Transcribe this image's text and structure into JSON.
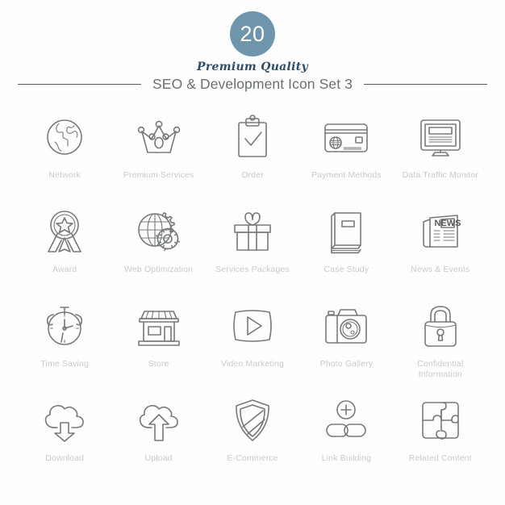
{
  "header": {
    "badge_number": "20",
    "badge_color": "#6f95ac",
    "tagline": "Premium Quality",
    "tagline_color": "#2e4d66",
    "title": "SEO & Development Icon Set 3",
    "title_color": "#6b6f73",
    "rule_color": "#555a5e"
  },
  "palette": {
    "background": "#fefefe",
    "icon_stroke": "#76797c",
    "label_color": "#c9cacb"
  },
  "grid": {
    "columns": 5,
    "rows": 4,
    "items": [
      {
        "label": "Network",
        "icon": "globe-network-icon"
      },
      {
        "label": "Premium Services",
        "icon": "crown-icon"
      },
      {
        "label": "Order",
        "icon": "clipboard-check-icon"
      },
      {
        "label": "Payment Methods",
        "icon": "credit-card-icon"
      },
      {
        "label": "Data Traffic Monitor",
        "icon": "monitor-icon"
      },
      {
        "label": "Award",
        "icon": "award-ribbon-icon"
      },
      {
        "label": "Web Optimization",
        "icon": "globe-gear-icon"
      },
      {
        "label": "Services Packages",
        "icon": "gift-box-icon"
      },
      {
        "label": "Case Study",
        "icon": "book-icon"
      },
      {
        "label": "News & Events",
        "icon": "newspaper-icon"
      },
      {
        "label": "Time Saving",
        "icon": "alarm-clock-icon"
      },
      {
        "label": "Store",
        "icon": "storefront-icon"
      },
      {
        "label": "Video Marketing",
        "icon": "video-play-icon"
      },
      {
        "label": "Photo Gallery",
        "icon": "camera-icon"
      },
      {
        "label": "Confidential Information",
        "icon": "padlock-icon"
      },
      {
        "label": "Download",
        "icon": "cloud-download-icon"
      },
      {
        "label": "Upload",
        "icon": "cloud-upload-icon"
      },
      {
        "label": "E-Commerce",
        "icon": "shield-icon"
      },
      {
        "label": "Link Building",
        "icon": "chain-link-plus-icon"
      },
      {
        "label": "Related Content",
        "icon": "puzzle-icon"
      }
    ]
  },
  "icon_text": {
    "newspaper_heading": "NEWS"
  }
}
